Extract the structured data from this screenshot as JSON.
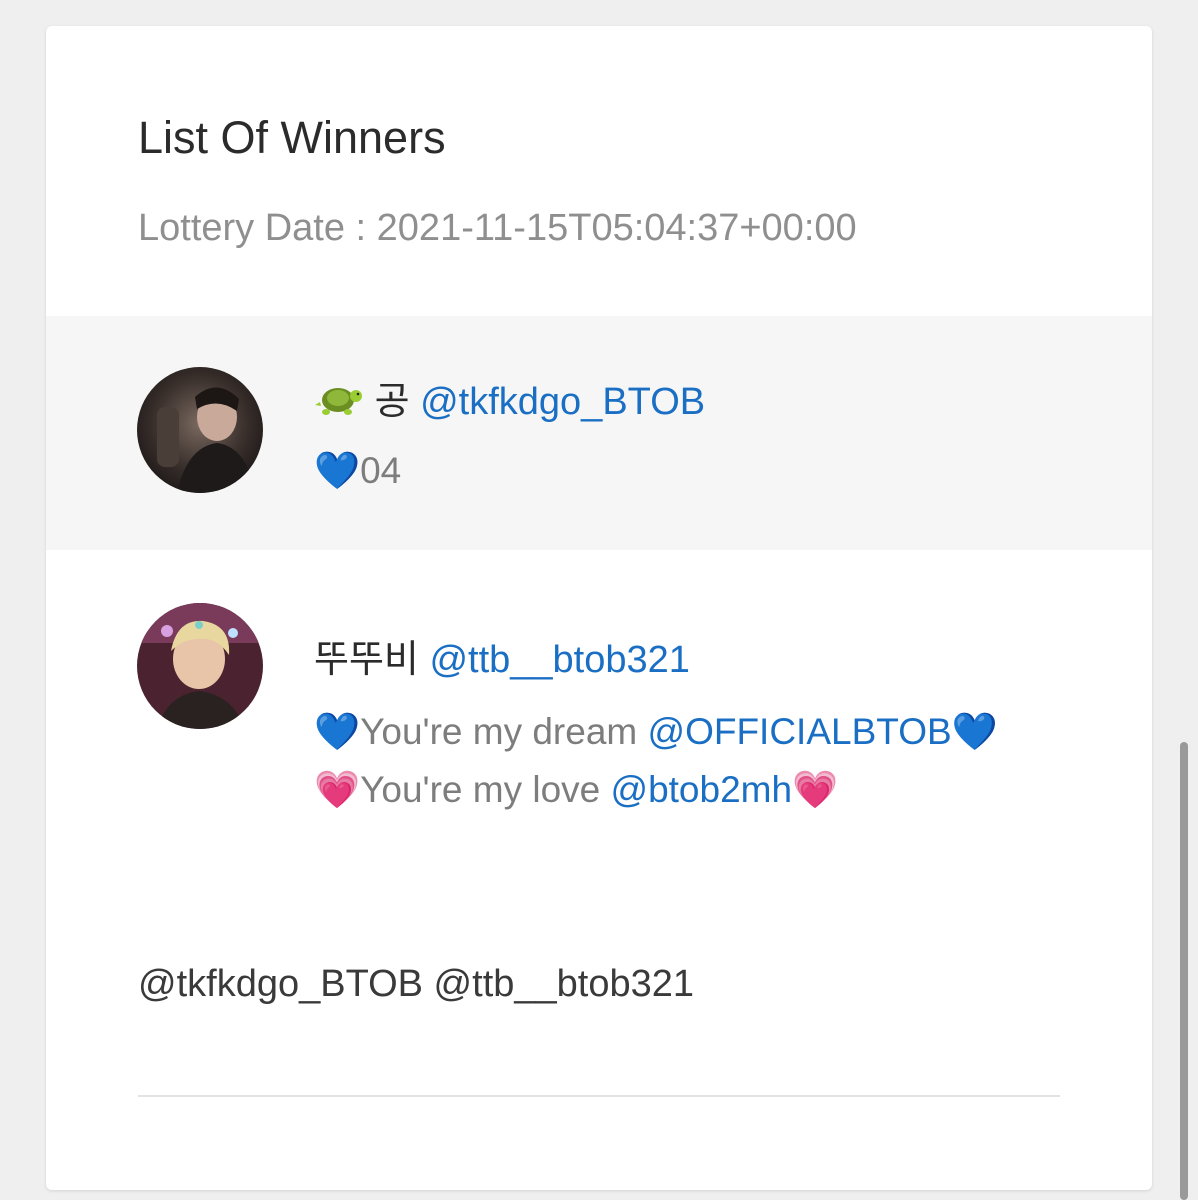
{
  "header": {
    "title": "List Of Winners",
    "lottery_date": "Lottery Date : 2021-11-15T05:04:37+00:00"
  },
  "winners": [
    {
      "display_name": "공",
      "name_icon": "turtle-emoji",
      "handle": "@tkfkdgo_BTOB",
      "message_emoji": "💙",
      "message_text": "04"
    },
    {
      "display_name": "뚜뚜비",
      "handle": "@ttb__btob321",
      "line1_emoji": "💙",
      "line1_text": "You're my dream ",
      "line1_mention": "@OFFICIALBTOB",
      "line1_emoji_end": "💙",
      "line2_emoji": "💗",
      "line2_text": "You're my love ",
      "line2_mention": "@btob2mh",
      "line2_emoji_end": "💗"
    }
  ],
  "mentions_line": "@tkfkdgo_BTOB @ttb__btob321",
  "colors": {
    "link": "#1a6fc4",
    "row_highlight": "#f6f6f6",
    "background": "#efefef"
  }
}
